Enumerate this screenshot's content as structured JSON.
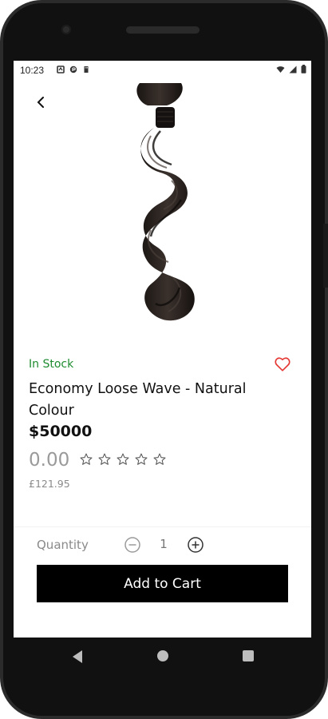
{
  "status_bar": {
    "time": "10:23",
    "left_icons": [
      "notification-icon",
      "pocket-icon",
      "sd-card-icon"
    ],
    "right_icons": [
      "wifi-icon",
      "signal-icon",
      "battery-icon"
    ]
  },
  "product": {
    "stock_status": "In Stock",
    "name": "Economy Loose Wave - Natural Colour",
    "price": "$50000",
    "rating": "0.00",
    "rating_stars": 0,
    "rating_max": 5,
    "old_price": "£121.95",
    "image_icon": "hair-bundle-image"
  },
  "quantity": {
    "label": "Quantity",
    "value": "1"
  },
  "actions": {
    "add_to_cart_label": "Add to Cart"
  },
  "colors": {
    "stock_green": "#1e8c2f",
    "favorite_red": "#e53935",
    "button_black": "#000000"
  }
}
